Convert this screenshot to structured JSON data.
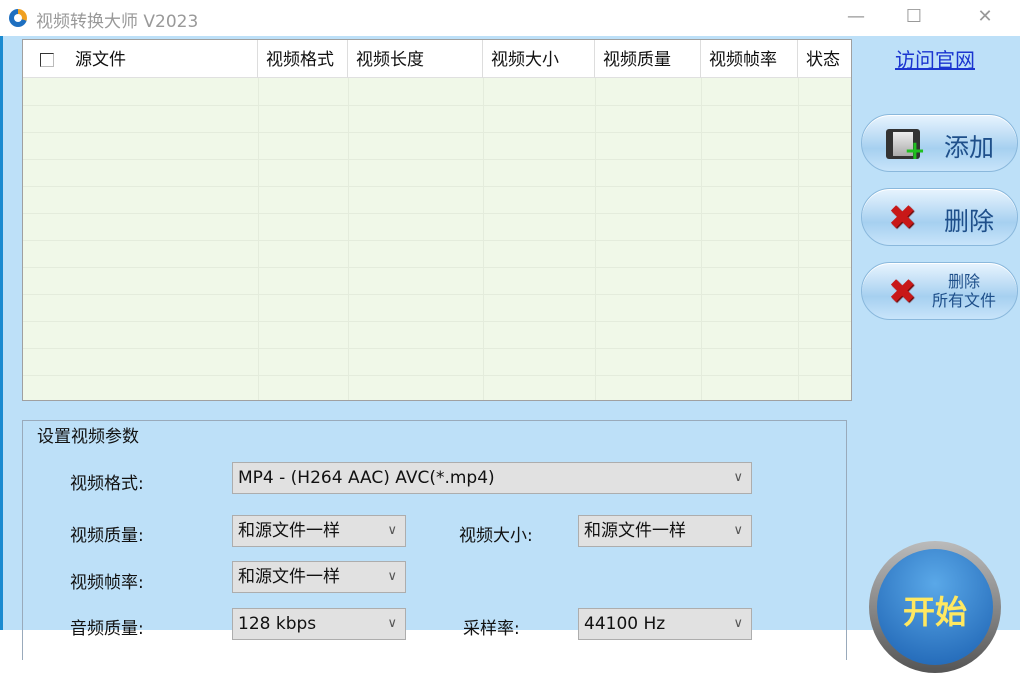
{
  "window": {
    "title": "视频转换大师 V2023",
    "minimize": "—",
    "maximize": "☐",
    "close": "✕"
  },
  "table": {
    "columns": [
      "源文件",
      "视频格式",
      "视频长度",
      "视频大小",
      "视频质量",
      "视频帧率",
      "状态"
    ]
  },
  "sidebar": {
    "visit_link": "访问官网",
    "add": "添加",
    "delete": "删除",
    "delete_all_line1": "删除",
    "delete_all_line2": "所有文件"
  },
  "settings": {
    "group_title": "设置视频参数",
    "format_label": "视频格式:",
    "format_value": "MP4 - (H264 AAC) AVC(*.mp4)",
    "quality_label": "视频质量:",
    "quality_value": "和源文件一样",
    "size_label": "视频大小:",
    "size_value": "和源文件一样",
    "framerate_label": "视频帧率:",
    "framerate_value": "和源文件一样",
    "audio_label": "音频质量:",
    "audio_value": "128 kbps",
    "samplerate_label": "采样率:",
    "samplerate_value": "44100 Hz"
  },
  "start_label": "开始",
  "colors": {
    "background": "#bde0f8",
    "table_bg": "#f0f8e8",
    "link": "#1a35d0"
  }
}
